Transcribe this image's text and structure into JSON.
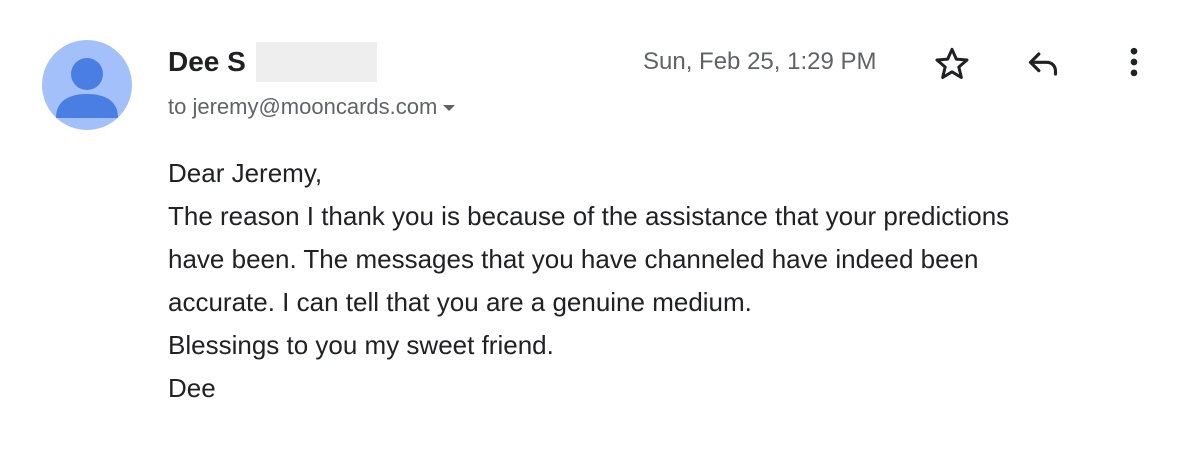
{
  "message": {
    "sender_name": "Dee S",
    "recipient": "to jeremy@mooncards.com",
    "date": "Sun, Feb 25, 1:29 PM",
    "body_lines": [
      "Dear Jeremy,",
      "The reason I thank you is because of the assistance that your predictions",
      "have been. The messages that you have channeled have indeed been",
      "accurate. I can tell that you are a genuine medium.",
      "Blessings to you my sweet friend.",
      "Dee"
    ]
  },
  "icons": {
    "avatar": "person-avatar-icon",
    "recipient_details": "chevron-down-icon",
    "star": "star-outline-icon",
    "reply": "reply-icon",
    "more": "more-vert-icon"
  },
  "colors": {
    "avatar_background": "#a3c0fb",
    "avatar_figure": "#4a7ee3",
    "secondary_text": "#5f6368",
    "primary_text": "#202124",
    "redaction": "#eeeeee"
  }
}
